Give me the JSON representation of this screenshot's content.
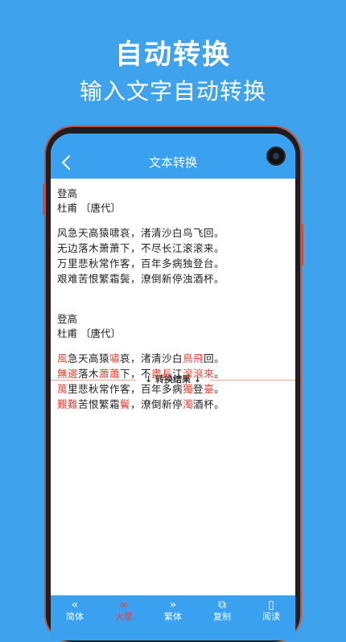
{
  "promo": {
    "headline": "自动转换",
    "subline": "输入文字自动转换"
  },
  "appbar": {
    "title": "文本转换",
    "back_icon": "chevron-left-icon"
  },
  "source": {
    "title": "登高",
    "author": "杜甫 〔唐代〕",
    "lines": [
      "风急天高猿啸哀，渚清沙白鸟飞回。",
      "无边落木萧萧下，不尽长江滚滚来。",
      "万里悲秋常作客，百年多病独登台。",
      "艰难苦恨繁霜鬓，潦倒新停浊酒杯。"
    ]
  },
  "divider": {
    "label": "↓ 转换结果 ↓",
    "color": "#e9a79a"
  },
  "result": {
    "title": "登高",
    "author": "杜甫 〔唐代〕",
    "highlight_color": "#e2453c",
    "lines": [
      [
        {
          "t": "風",
          "h": true
        },
        {
          "t": "急天高猿",
          "h": false
        },
        {
          "t": "嘯",
          "h": true
        },
        {
          "t": "哀，渚清沙白",
          "h": false
        },
        {
          "t": "鳥飛",
          "h": true
        },
        {
          "t": "回。",
          "h": false
        }
      ],
      [
        {
          "t": "無邊",
          "h": true
        },
        {
          "t": "落木",
          "h": false
        },
        {
          "t": "蕭蕭",
          "h": true
        },
        {
          "t": "下，不",
          "h": false
        },
        {
          "t": "盡長",
          "h": true
        },
        {
          "t": "江",
          "h": false
        },
        {
          "t": "滾滾來",
          "h": true
        },
        {
          "t": "。",
          "h": false
        }
      ],
      [
        {
          "t": "萬",
          "h": true
        },
        {
          "t": "里悲秋常作客，百年多病",
          "h": false
        },
        {
          "t": "獨",
          "h": true
        },
        {
          "t": "登",
          "h": false
        },
        {
          "t": "臺",
          "h": true
        },
        {
          "t": "。",
          "h": false
        }
      ],
      [
        {
          "t": "艱難",
          "h": true
        },
        {
          "t": "苦恨繁霜",
          "h": false
        },
        {
          "t": "鬢",
          "h": true
        },
        {
          "t": "，潦倒新停",
          "h": false
        },
        {
          "t": "濁",
          "h": true
        },
        {
          "t": "酒杯。",
          "h": false
        }
      ]
    ]
  },
  "bottom_tabs": [
    {
      "label": "简体",
      "icon": "double-chevron-left-icon",
      "glyph": "«",
      "active": false
    },
    {
      "label": "火星",
      "icon": "mars-icon",
      "glyph": "∞",
      "active": true
    },
    {
      "label": "繁体",
      "icon": "double-chevron-right-icon",
      "glyph": "»",
      "active": false
    },
    {
      "label": "复制",
      "icon": "copy-icon",
      "glyph": "⧉",
      "active": false
    },
    {
      "label": "阅读",
      "icon": "book-icon",
      "glyph": "▯",
      "active": false
    }
  ],
  "colors": {
    "background": "#3ea3ec",
    "appbar": "#3aa0f0",
    "phone_frame": "#c0553b"
  }
}
